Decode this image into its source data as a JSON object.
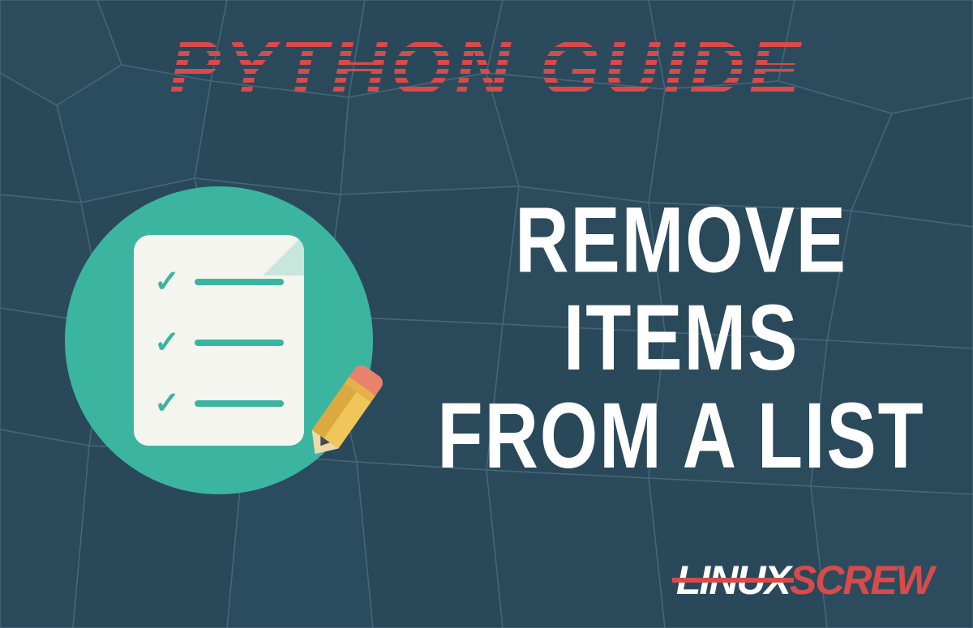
{
  "header": {
    "title": "PYTHON GUIDE"
  },
  "main": {
    "line1": "REMOVE ITEMS",
    "line2": "FROM A LIST"
  },
  "logo": {
    "part1": "LINUX",
    "part2": "SCREW"
  },
  "icon": {
    "name": "checklist-icon"
  },
  "colors": {
    "background": "#2a4a5c",
    "accent_teal": "#3cb5a0",
    "accent_red": "#d94a4a",
    "text_white": "#ffffff"
  }
}
